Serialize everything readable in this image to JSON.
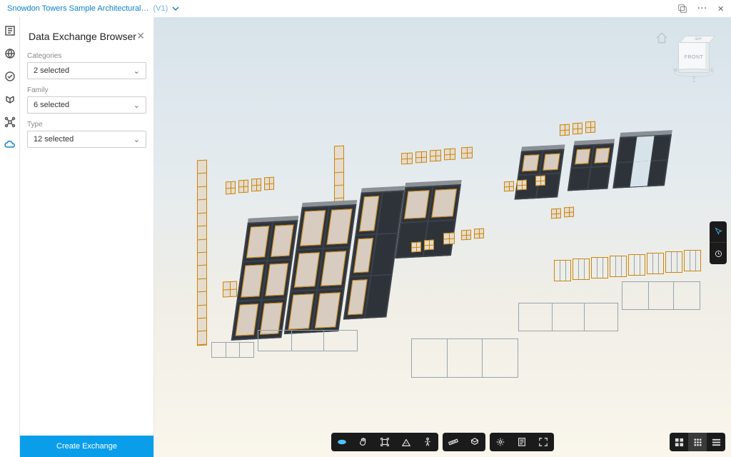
{
  "header": {
    "file_title": "Snowdon Towers Sample Architectural…",
    "version_label": "(V1)"
  },
  "panel": {
    "title": "Data Exchange Browser",
    "filters": {
      "categories": {
        "label": "Categories",
        "value": "2 selected"
      },
      "family": {
        "label": "Family",
        "value": "6 selected"
      },
      "type": {
        "label": "Type",
        "value": "12 selected"
      }
    },
    "create_button": "Create Exchange"
  },
  "viewcube": {
    "top": "TOP",
    "front": "FRONT"
  },
  "rail_icons": [
    "project",
    "globe",
    "approve",
    "model-compare",
    "connector",
    "cloud"
  ],
  "top_right_icons": [
    "layers",
    "more",
    "close"
  ],
  "right_toolbar": [
    "cursor",
    "clock"
  ],
  "bottom_right_toolbar": [
    "thumbs",
    "grid",
    "list"
  ],
  "bottom_toolbar": {
    "group1": [
      "orbit",
      "pan",
      "zoom-extents",
      "first-person",
      "walk"
    ],
    "group2": [
      "measure",
      "explode"
    ],
    "group3": [
      "settings",
      "properties",
      "fullscreen"
    ]
  }
}
